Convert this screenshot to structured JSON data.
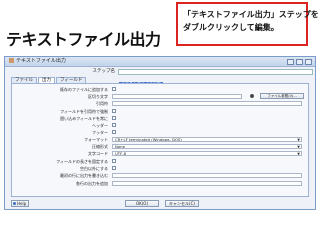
{
  "headline": "テキストファイル出力",
  "callout": {
    "line1": "「テキストファイル出力」ステップを",
    "line2": "ダブルクリックして編集。"
  },
  "dialog": {
    "title": "テキストファイル出力",
    "step_name_label": "ステップ名",
    "step_name_value": "テキストファイル出力",
    "tabs": [
      "ファイル",
      "出力",
      "フィールド"
    ],
    "active_tab": 1,
    "browse_button": "ファイル参照(V)...",
    "rows": [
      {
        "label": "既存のファイルに追加する"
      },
      {
        "label": "区切り文字"
      },
      {
        "label": "引用符"
      },
      {
        "label": "フィールドを引用符で強制"
      },
      {
        "label": "囲い込みフィールドを常に"
      },
      {
        "label": "ヘッダー"
      },
      {
        "label": "フッター"
      },
      {
        "label": "フォーマット",
        "value": "CR+LF terminated (Windows, DOS)"
      },
      {
        "label": "圧縮形式",
        "value": "None"
      },
      {
        "label": "文字コード",
        "value": "UTF-8"
      },
      {
        "label": "フィールドの長さを固定する"
      },
      {
        "label": "空白以外にする"
      },
      {
        "label": "最初の行に出力を書き込む"
      },
      {
        "label": "各行の出力を追加"
      }
    ],
    "help_button": "Help",
    "ok_button": "OK(O)",
    "cancel_button": "キャンセル(C)"
  }
}
